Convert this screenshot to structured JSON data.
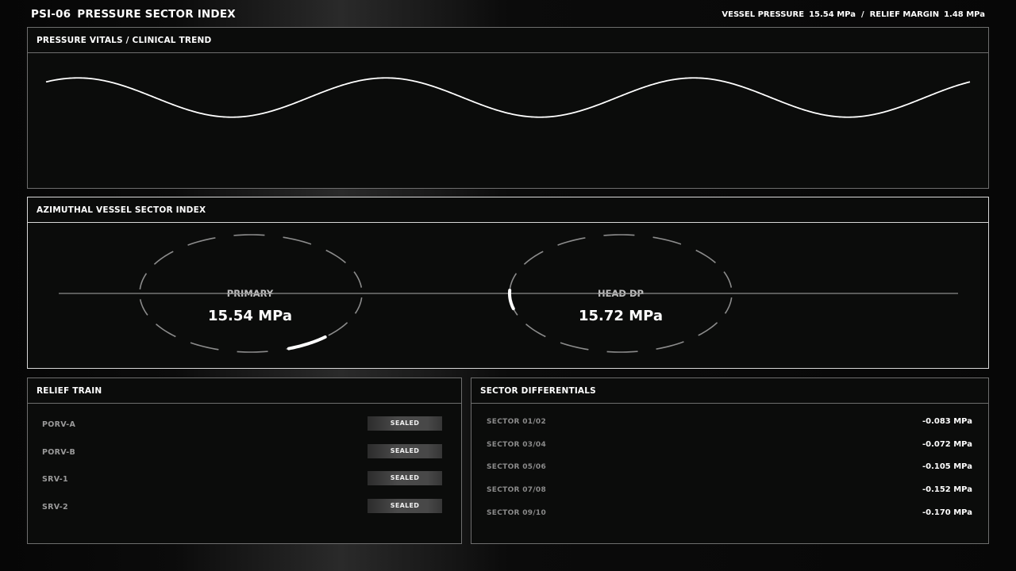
{
  "header": {
    "code": "PSI-06",
    "title": "PRESSURE SECTOR INDEX",
    "vessel_pressure_label": "VESSEL PRESSURE",
    "vessel_pressure_value": "15.54 MPa",
    "separator": "/",
    "relief_margin_label": "RELIEF MARGIN",
    "relief_margin_value": "1.48 MPa"
  },
  "trend": {
    "title": "PRESSURE VITALS / CLINICAL TREND",
    "line_color": "#ffffff"
  },
  "sector_index": {
    "title": "AZIMUTHAL VESSEL SECTOR INDEX",
    "gauges": [
      {
        "label": "PRIMARY",
        "value": "15.54 MPa",
        "indicator": "lower-right"
      },
      {
        "label": "HEAD DP",
        "value": "15.72 MPa",
        "indicator": "left"
      }
    ]
  },
  "relief_train": {
    "title": "RELIEF TRAIN",
    "items": [
      {
        "name": "PORV-A",
        "status": "SEALED"
      },
      {
        "name": "PORV-B",
        "status": "SEALED"
      },
      {
        "name": "SRV-1",
        "status": "SEALED"
      },
      {
        "name": "SRV-2",
        "status": "SEALED"
      }
    ]
  },
  "sector_differentials": {
    "title": "SECTOR DIFFERENTIALS",
    "rows": [
      {
        "name": "SECTOR 01/02",
        "value": "-0.083 MPa"
      },
      {
        "name": "SECTOR 03/04",
        "value": "-0.072 MPa"
      },
      {
        "name": "SECTOR 05/06",
        "value": "-0.105 MPa"
      },
      {
        "name": "SECTOR 07/08",
        "value": "-0.152 MPa"
      },
      {
        "name": "SECTOR 09/10",
        "value": "-0.170 MPa"
      }
    ]
  },
  "colors": {
    "background": "#0a0a0a",
    "panel_border": "#6e6e6e",
    "panel_border_active": "#d8d8d8",
    "text": "#ffffff",
    "muted_text": "#9a9a9a"
  }
}
